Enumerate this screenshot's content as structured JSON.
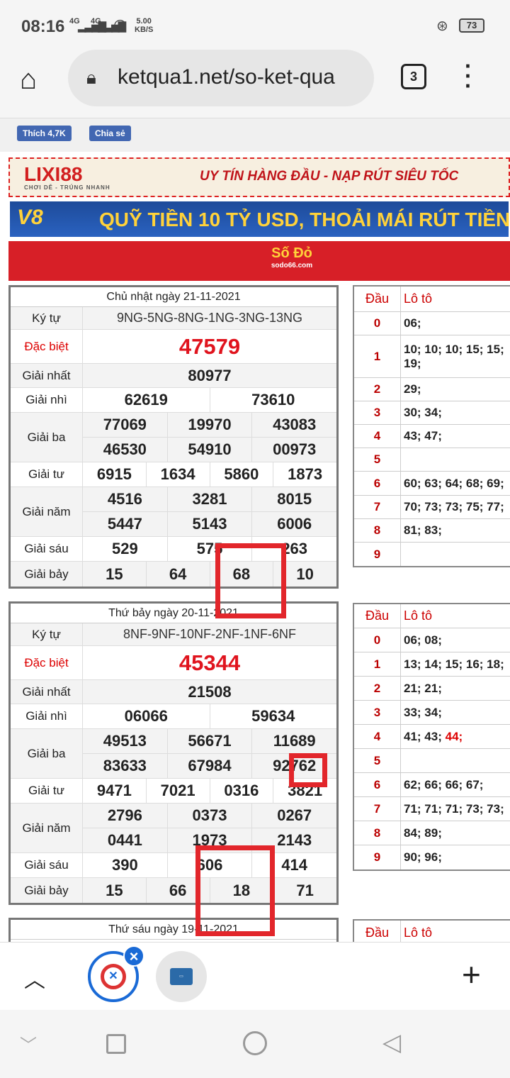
{
  "status_bar": {
    "time": "08:16",
    "network1": "4G",
    "network2": "4G",
    "speed_value": "5.00",
    "speed_unit": "KB/S",
    "battery": "73"
  },
  "browser": {
    "url": "ketqua1.net/so-ket-qua",
    "tab_count": "3"
  },
  "social": {
    "like_label": "Thích 4,7K",
    "share_label": "Chia sẻ"
  },
  "banners": {
    "lixi_logo": "LIXI88",
    "lixi_sub": "CHƠI DỄ - TRÚNG NHANH",
    "lixi_text": "UY TÍN HÀNG ĐẦU - NẠP RÚT SIÊU TỐC",
    "v8_logo": "V8",
    "v8_text": "QUỸ TIỀN 10 TỶ USD, THOẢI MÁI RÚT TIỀN",
    "sodo_logo": "Số Đỏ",
    "sodo_sub": "sodo66.com"
  },
  "results": [
    {
      "date": "Chủ nhật ngày 21-11-2021",
      "ky_tu_label": "Ký tự",
      "ky_tu": "9NG-5NG-8NG-1NG-3NG-13NG",
      "db_label": "Đặc biệt",
      "db": "47579",
      "g1_label": "Giải nhất",
      "g1": "80977",
      "g2_label": "Giải nhì",
      "g2": [
        "62619",
        "73610"
      ],
      "g3_label": "Giải ba",
      "g3": [
        "77069",
        "19970",
        "43083",
        "46530",
        "54910",
        "00973"
      ],
      "g4_label": "Giải tư",
      "g4": [
        "6915",
        "1634",
        "5860",
        "1873"
      ],
      "g5_label": "Giải năm",
      "g5": [
        "4516",
        "3281",
        "8015",
        "5447",
        "5143",
        "6006"
      ],
      "g6_label": "Giải sáu",
      "g6": [
        "529",
        "575",
        "263"
      ],
      "g7_label": "Giải bảy",
      "g7": [
        "15",
        "64",
        "68",
        "10"
      ]
    },
    {
      "date": "Thứ bảy ngày 20-11-2021",
      "ky_tu_label": "Ký tự",
      "ky_tu": "8NF-9NF-10NF-2NF-1NF-6NF",
      "db_label": "Đặc biệt",
      "db": "45344",
      "g1_label": "Giải nhất",
      "g1": "21508",
      "g2_label": "Giải nhì",
      "g2": [
        "06066",
        "59634"
      ],
      "g3_label": "Giải ba",
      "g3": [
        "49513",
        "56671",
        "11689",
        "83633",
        "67984",
        "92762"
      ],
      "g4_label": "Giải tư",
      "g4": [
        "9471",
        "7021",
        "0316",
        "3821"
      ],
      "g5_label": "Giải năm",
      "g5": [
        "2796",
        "0373",
        "0267",
        "0441",
        "1973",
        "2143"
      ],
      "g6_label": "Giải sáu",
      "g6": [
        "390",
        "606",
        "414"
      ],
      "g7_label": "Giải bảy",
      "g7": [
        "15",
        "66",
        "18",
        "71"
      ]
    },
    {
      "date": "Thứ sáu ngày 19-11-2021"
    }
  ],
  "loto_header": {
    "dau": "Đầu",
    "loto": "Lô tô"
  },
  "loto": [
    [
      {
        "d": "0",
        "v": "06;"
      },
      {
        "d": "1",
        "v": "10; 10; 10; 15; 15; 19;"
      },
      {
        "d": "2",
        "v": "29;"
      },
      {
        "d": "3",
        "v": "30; 34;"
      },
      {
        "d": "4",
        "v": "43; 47;"
      },
      {
        "d": "5",
        "v": ""
      },
      {
        "d": "6",
        "v": "60; 63; 64; 68; 69;"
      },
      {
        "d": "7",
        "v": "70; 73; 73; 75; 77;"
      },
      {
        "d": "8",
        "v": "81; 83;"
      },
      {
        "d": "9",
        "v": ""
      }
    ],
    [
      {
        "d": "0",
        "v": "06; 08;"
      },
      {
        "d": "1",
        "v": "13; 14; 15; 16; 18;"
      },
      {
        "d": "2",
        "v": "21; 21;"
      },
      {
        "d": "3",
        "v": "33; 34;"
      },
      {
        "d": "4",
        "v": "41; 43;",
        "hot": "44;"
      },
      {
        "d": "5",
        "v": ""
      },
      {
        "d": "6",
        "v": "62; 66; 66; 67;"
      },
      {
        "d": "7",
        "v": "71; 71; 71; 73; 73;"
      },
      {
        "d": "8",
        "v": "84; 89;"
      },
      {
        "d": "9",
        "v": "90; 96;"
      }
    ]
  ],
  "highlight_color": "#e2262b",
  "accent_red": "#e0141e",
  "icons": [
    "home-icon",
    "lock-icon",
    "tabs-icon",
    "more-icon",
    "chevron-up-icon",
    "plus-icon",
    "close-icon"
  ]
}
